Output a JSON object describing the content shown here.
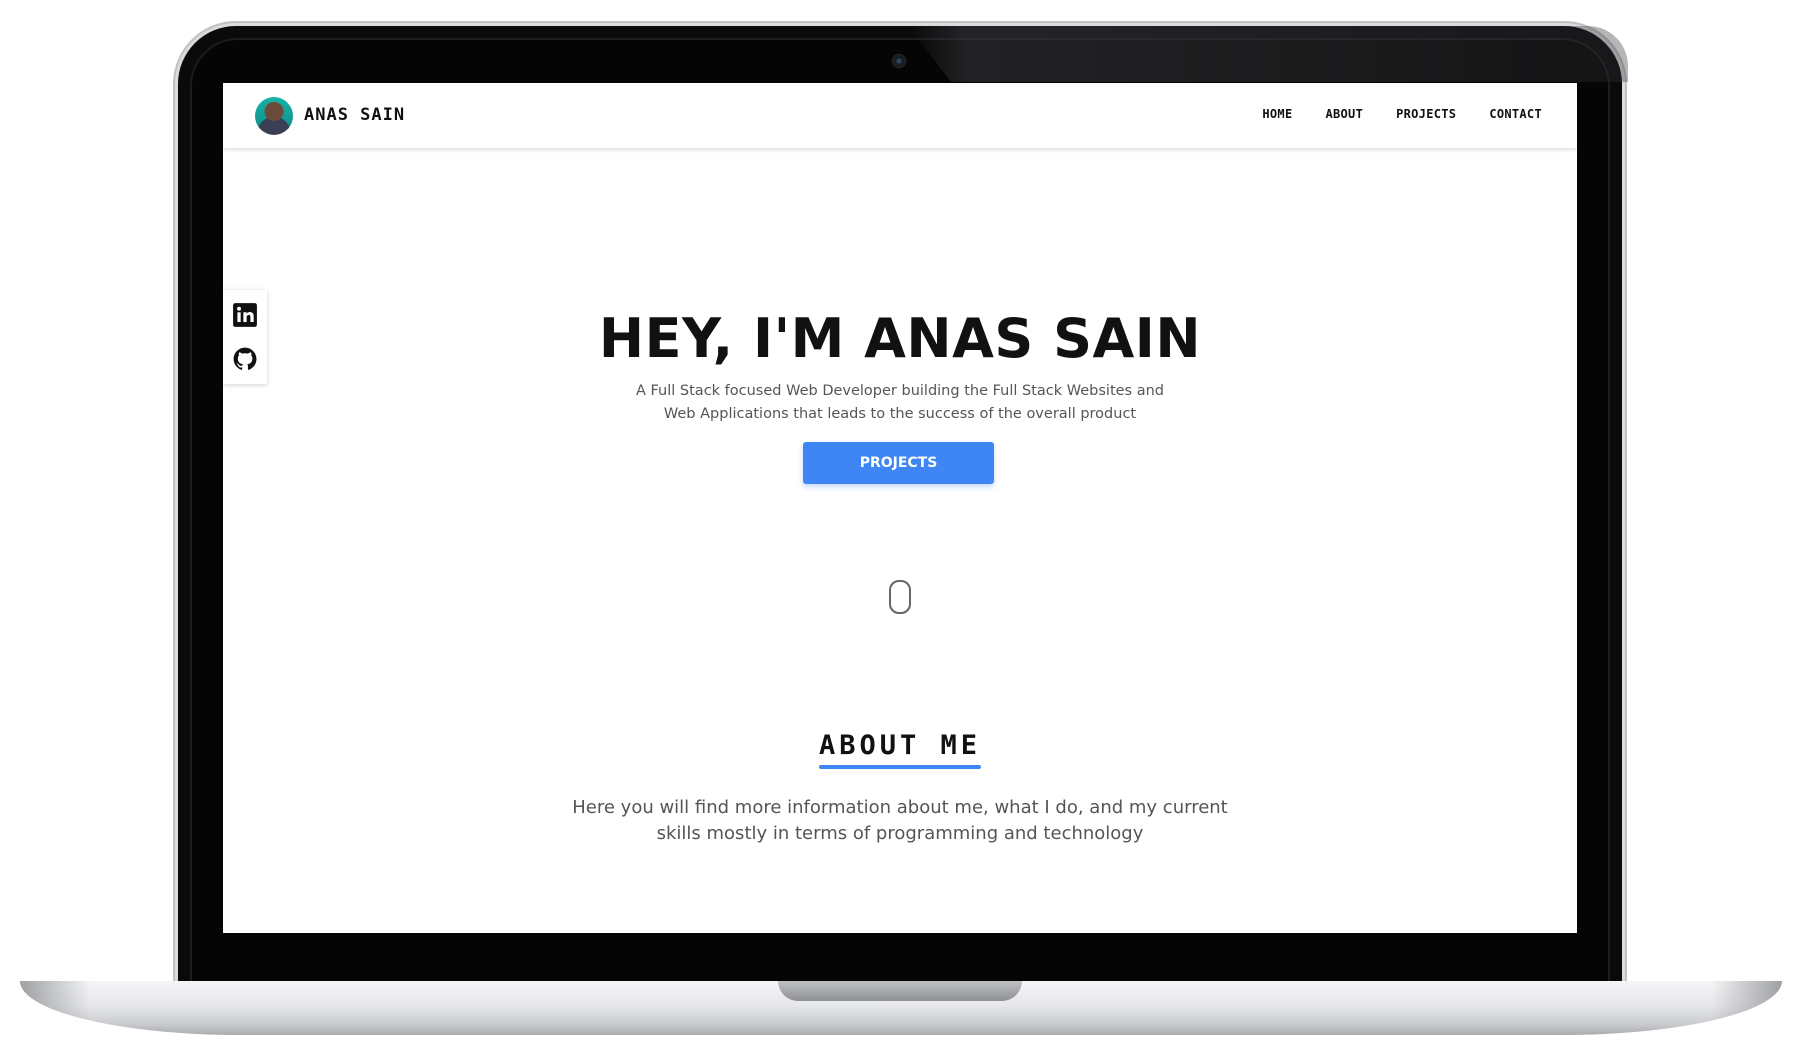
{
  "site": {
    "brand": "ANAS SAIN",
    "nav": [
      "HOME",
      "ABOUT",
      "PROJECTS",
      "CONTACT"
    ]
  },
  "social": {
    "icons": [
      "linkedin-icon",
      "github-icon"
    ]
  },
  "hero": {
    "title": "HEY, I'M ANAS SAIN",
    "subtitle": "A Full Stack focused Web Developer building the Full Stack Websites and Web Applications that leads to the success of the overall product",
    "button": "PROJECTS"
  },
  "about": {
    "title": "ABOUT ME",
    "text": "Here you will find more information about me, what I do, and my current skills mostly in terms of programming and technology"
  },
  "colors": {
    "accent": "#3e86f4"
  }
}
